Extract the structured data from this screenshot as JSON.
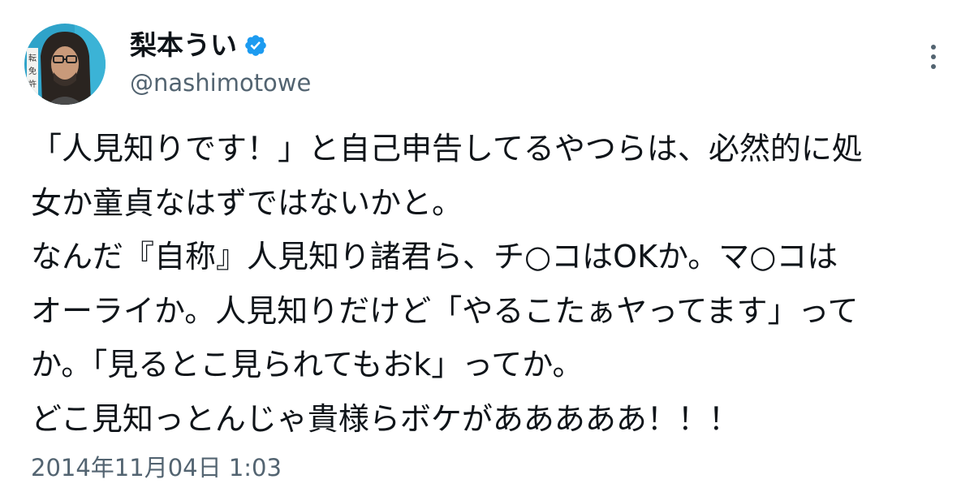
{
  "author": {
    "display_name": "梨本うい",
    "handle": "@nashimotowe",
    "verified": true,
    "avatar_icon": "user-avatar"
  },
  "menu": {
    "icon": "more-vertical-icon"
  },
  "tweet": {
    "lines": [
      "「人見知りです！」と自己申告してるやつらは、必然的に処",
      "女か童貞なはずではないかと。",
      "なんだ『自称』人見知り諸君ら、チ○コはOKか。マ○コは",
      "オーライか。人見知りだけど「やるこたぁヤってます」って",
      "か。「見るとこ見られてもおk」ってか。",
      "どこ見知っとんじゃ貴様らボケがあああああ！！！"
    ],
    "timestamp": "2014年11月04日 1:03"
  },
  "colors": {
    "text_primary": "#0f1419",
    "text_secondary": "#536471",
    "verified_blue": "#1d9bf0",
    "background": "#ffffff"
  }
}
